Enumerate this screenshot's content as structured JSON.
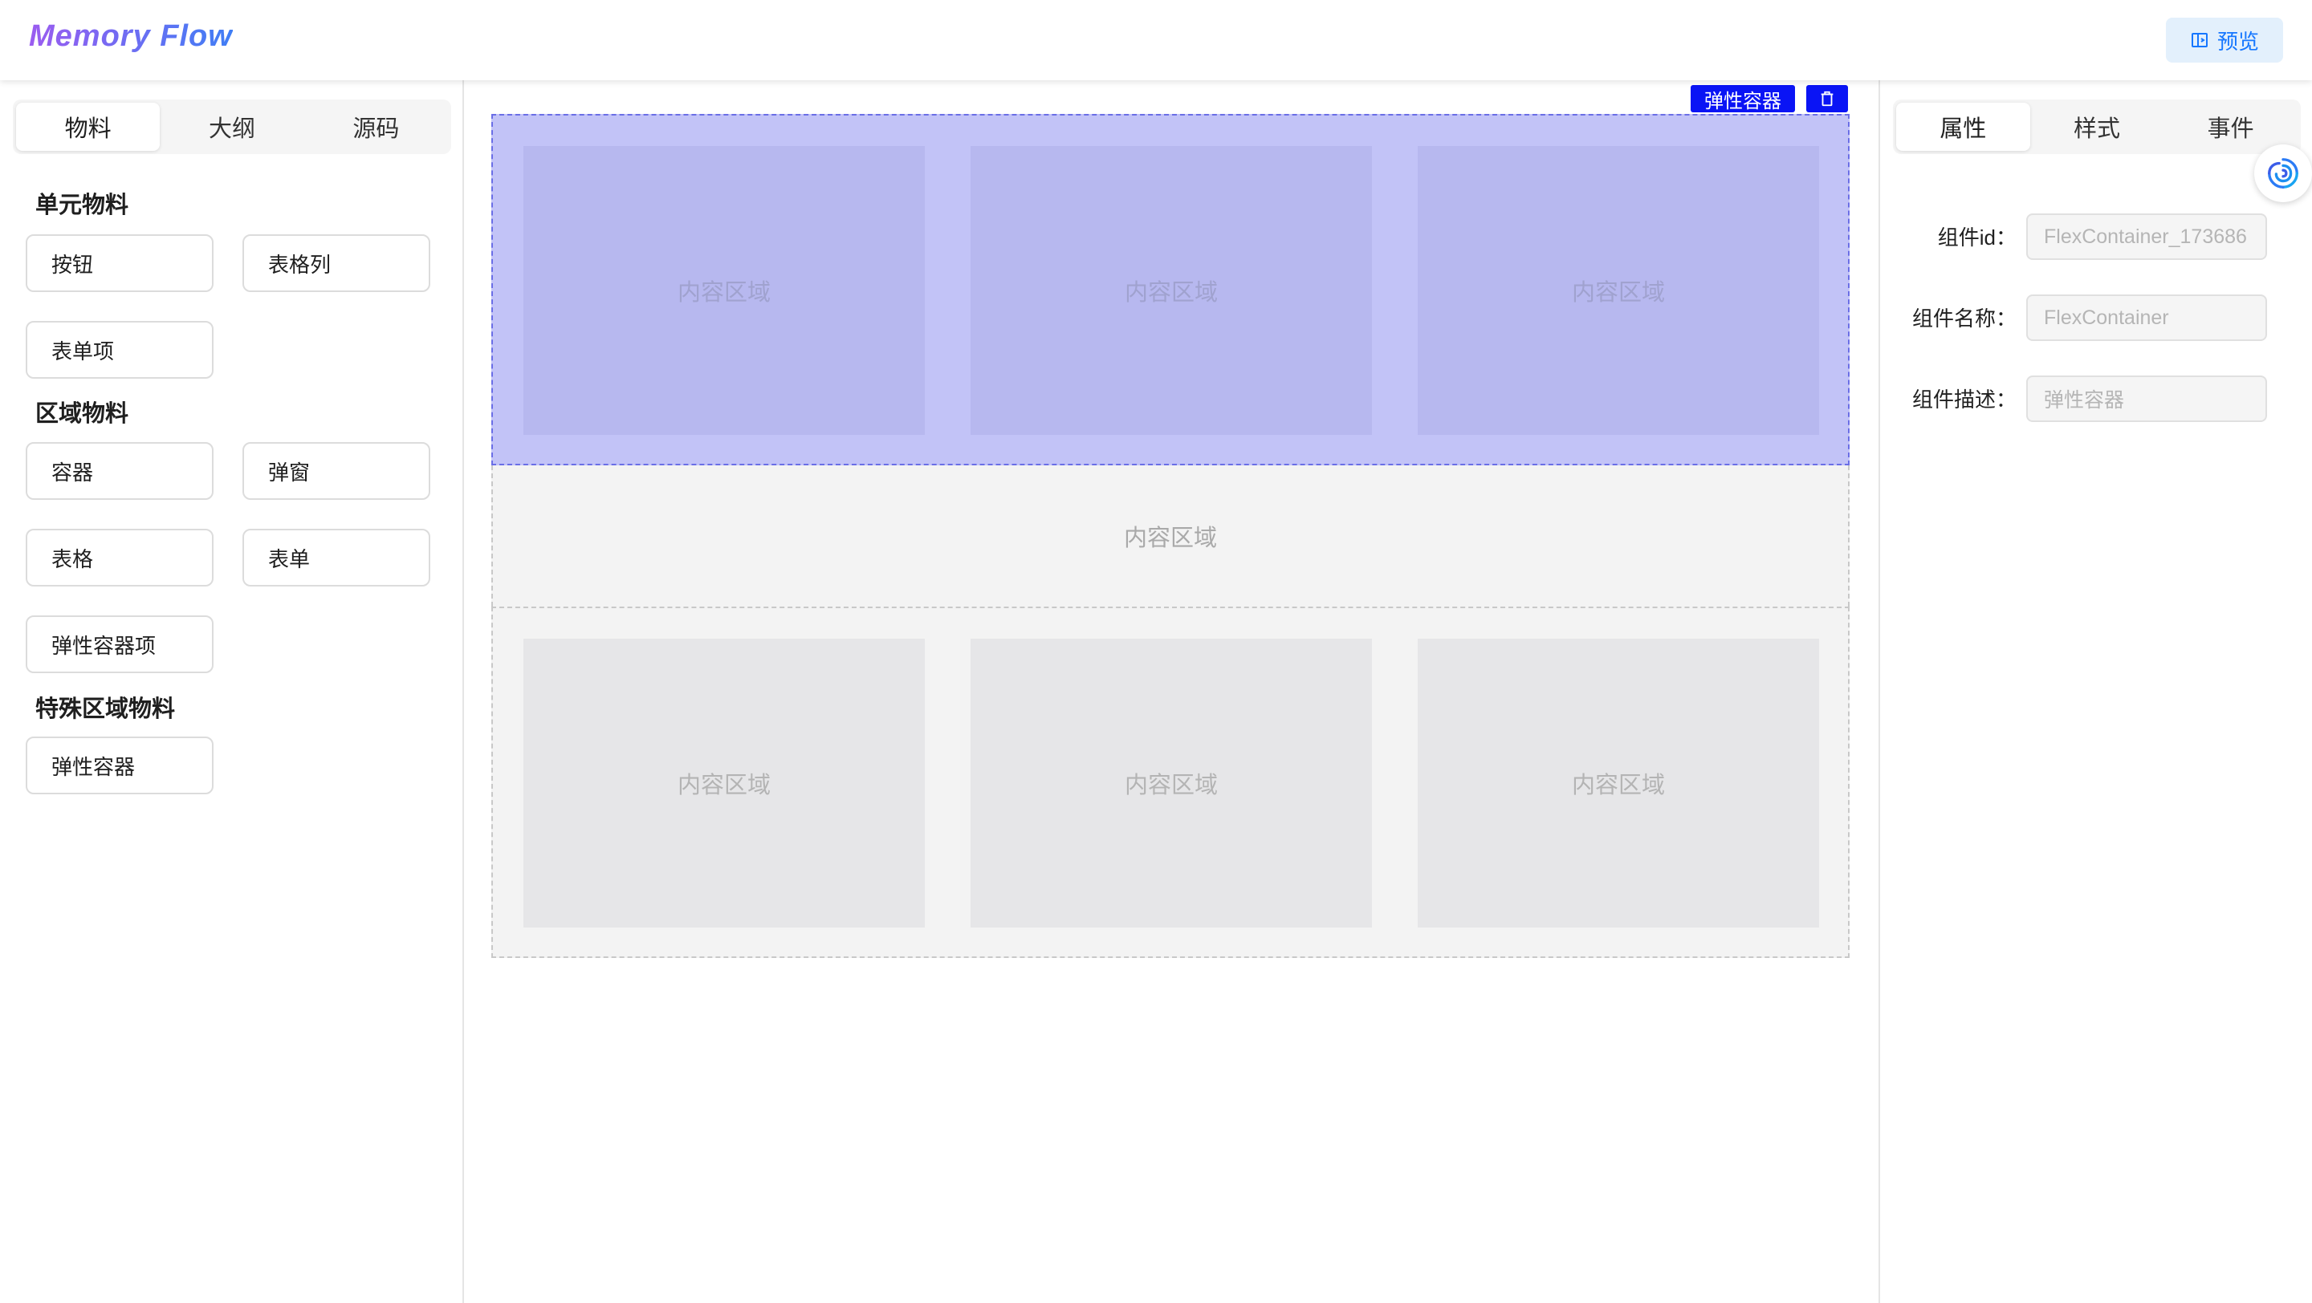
{
  "header": {
    "logo": "Memory Flow",
    "preview_label": "预览"
  },
  "left_panel": {
    "tabs": [
      {
        "label": "物料",
        "active": true
      },
      {
        "label": "大纲",
        "active": false
      },
      {
        "label": "源码",
        "active": false
      }
    ],
    "sections": [
      {
        "title": "单元物料",
        "items": [
          "按钮",
          "表格列",
          "表单项"
        ]
      },
      {
        "title": "区域物料",
        "items": [
          "容器",
          "弹窗",
          "表格",
          "表单",
          "弹性容器项"
        ]
      },
      {
        "title": "特殊区域物料",
        "items": [
          "弹性容器"
        ]
      }
    ]
  },
  "canvas": {
    "selection_label": "弹性容器",
    "selected_container_cells": [
      "内容区域",
      "内容区域",
      "内容区域"
    ],
    "content_area_label": "内容区域",
    "second_container_cells": [
      "内容区域",
      "内容区域",
      "内容区域"
    ]
  },
  "right_panel": {
    "tabs": [
      {
        "label": "属性",
        "active": true
      },
      {
        "label": "样式",
        "active": false
      },
      {
        "label": "事件",
        "active": false
      }
    ],
    "properties": [
      {
        "label": "组件id：",
        "placeholder": "FlexContainer_173686"
      },
      {
        "label": "组件名称：",
        "placeholder": "FlexContainer"
      },
      {
        "label": "组件描述：",
        "placeholder": "弹性容器"
      }
    ]
  },
  "colors": {
    "accent": "#1677ff",
    "selection": "#0a14f5",
    "selected_bg": "#c2c3f7"
  }
}
